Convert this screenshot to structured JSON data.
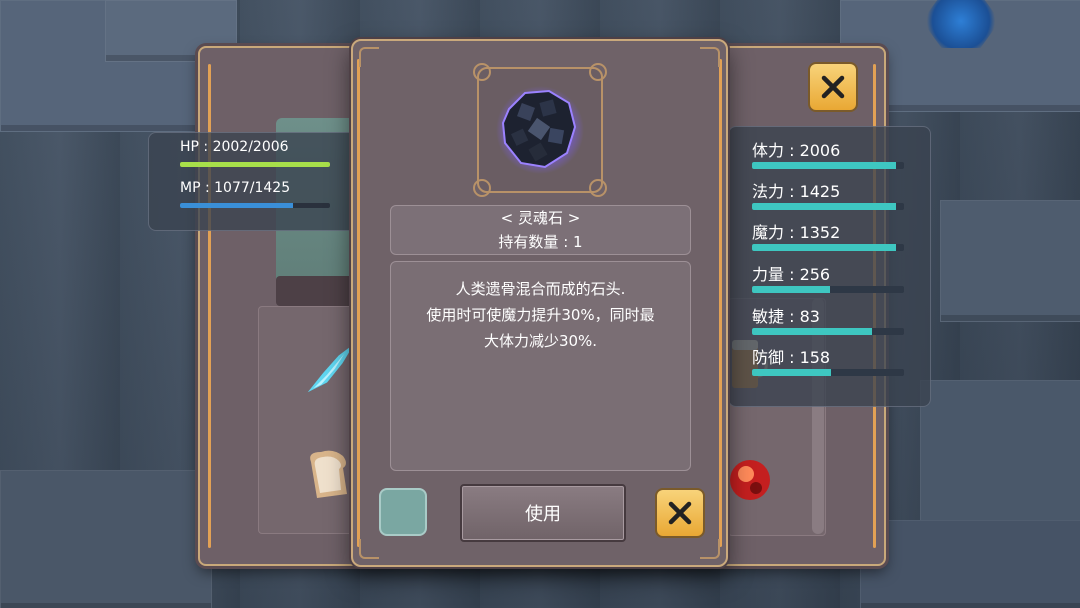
{
  "player": {
    "hp_label": "HP : 2002/2006",
    "hp_fraction": 0.998,
    "mp_label": "MP : 1077/1425",
    "mp_fraction": 0.756
  },
  "stats": [
    {
      "label": "体力 : 2006",
      "fraction": 0.95
    },
    {
      "label": "法力 : 1425",
      "fraction": 0.95
    },
    {
      "label": "魔力 : 1352",
      "fraction": 0.95
    },
    {
      "label": "力量 : 256",
      "fraction": 0.51
    },
    {
      "label": "敏捷 : 83",
      "fraction": 0.79
    },
    {
      "label": "防御 : 158",
      "fraction": 0.52
    }
  ],
  "item": {
    "name": "< 灵魂石 >",
    "quantity": "持有数量 : 1",
    "description_lines": [
      "人类遗骨混合而成的石头.",
      "使用时可使魔力提升30%，同时最",
      "大体力减少30%."
    ]
  },
  "buttons": {
    "use_label": "使用"
  },
  "colors": {
    "hp_bar": "#a8e04a",
    "mp_bar": "#3a8fd8",
    "stat_bar": "#3ec7c1",
    "close_button": "#f2c055",
    "rail": "#e2a155"
  },
  "icons": {
    "item": "soul-stone-icon",
    "close": "close-icon"
  }
}
